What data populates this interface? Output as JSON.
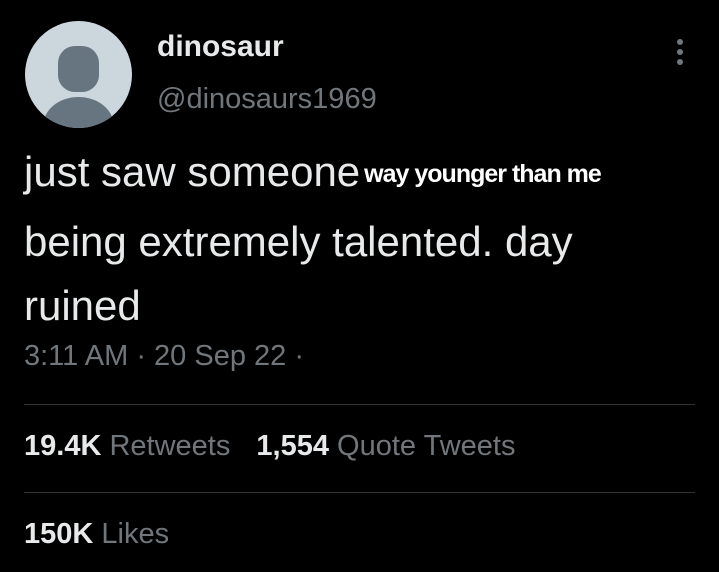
{
  "tweet": {
    "author": {
      "display_name": "dinosaur",
      "handle": "@dinosaurs1969"
    },
    "text_lines": [
      "just saw someone",
      "being extremely talented. day",
      "ruined"
    ],
    "overlay_caption": "way younger than me",
    "time": "3:11 AM",
    "separator": "·",
    "date": "20 Sep 22",
    "trailing_separator": "·",
    "stats": {
      "retweets": {
        "count": "19.4K",
        "label": "Retweets"
      },
      "quotes": {
        "count": "1,554",
        "label": "Quote Tweets"
      },
      "likes": {
        "count": "150K",
        "label": "Likes"
      }
    }
  },
  "icons": {
    "avatar": "default-avatar-icon",
    "more": "more-options-icon"
  },
  "colors": {
    "background": "#000000",
    "primary_text": "#e7e9ea",
    "secondary_text": "#71767b",
    "divider": "#2f3336",
    "avatar_bg": "#ccd6dd",
    "avatar_figure": "#66757f"
  }
}
